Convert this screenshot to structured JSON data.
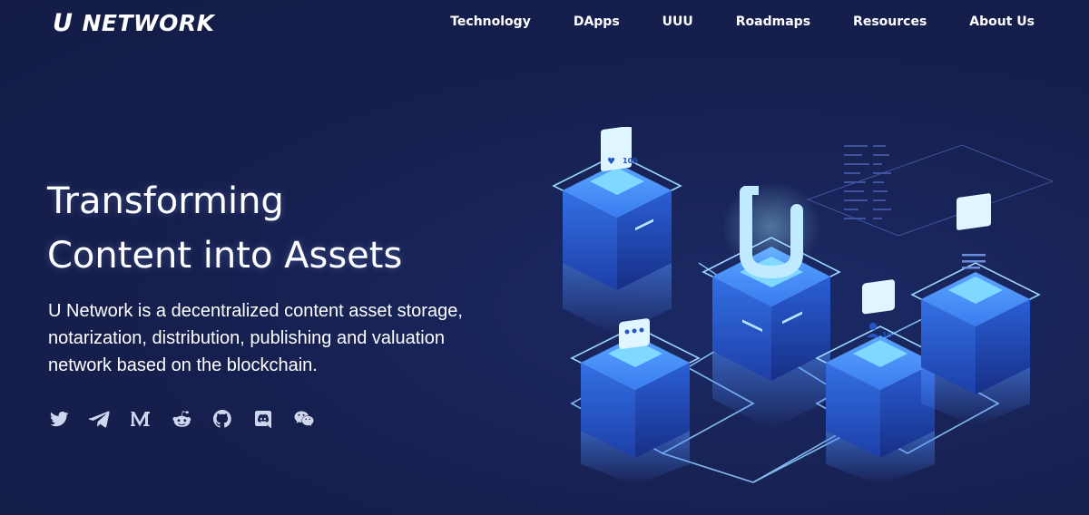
{
  "brand": {
    "mark": "U",
    "name": "NETWORK"
  },
  "nav": {
    "items": [
      {
        "label": "Technology"
      },
      {
        "label": "DApps"
      },
      {
        "label": "UUU"
      },
      {
        "label": "Roadmaps"
      },
      {
        "label": "Resources"
      },
      {
        "label": "About Us"
      }
    ]
  },
  "hero": {
    "title_lines": [
      "Transforming",
      "Content into Assets"
    ],
    "description_lines": [
      "U Network is a decentralized content asset storage,",
      "notarization, distribution, publishing and valuation",
      "network based on the blockchain."
    ]
  },
  "socials": [
    {
      "icon": "twitter-icon"
    },
    {
      "icon": "telegram-icon"
    },
    {
      "icon": "medium-icon"
    },
    {
      "icon": "reddit-icon"
    },
    {
      "icon": "github-icon"
    },
    {
      "icon": "discord-icon"
    },
    {
      "icon": "wechat-icon"
    }
  ],
  "illustration": {
    "like_count": "100",
    "user_count": "10",
    "logo_glyph": "U"
  },
  "colors": {
    "background": "#161f4d",
    "cube_top": "#3a7cf0",
    "cube_side": "#2456c8",
    "glow": "#7fd8ff"
  }
}
